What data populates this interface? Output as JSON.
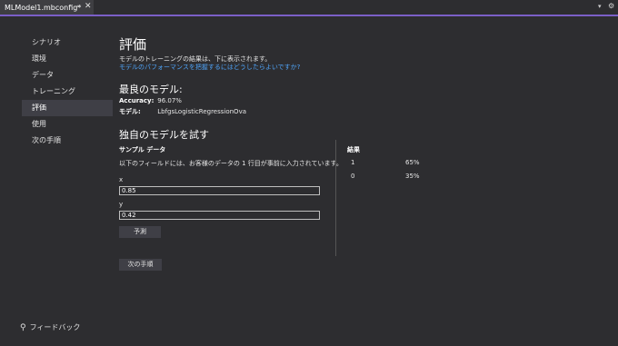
{
  "tab": {
    "title": "MLModel1.mbconfig*",
    "pin_icon": "pin-icon",
    "close_icon": "close-icon"
  },
  "sidebar": {
    "items": [
      {
        "label": "シナリオ"
      },
      {
        "label": "環境"
      },
      {
        "label": "データ"
      },
      {
        "label": "トレーニング"
      },
      {
        "label": "評価",
        "active": true
      },
      {
        "label": "使用"
      },
      {
        "label": "次の手順"
      }
    ],
    "feedback": "フィードバック"
  },
  "evaluate": {
    "title": "評価",
    "description": "モデルのトレーニングの結果は、下に表示されます。",
    "help_link": "モデルのパフォーマンスを把握するにはどうしたらよいですか?"
  },
  "best_model": {
    "heading": "最良のモデル:",
    "accuracy_label": "Accuracy:",
    "accuracy_value": "96.07%",
    "model_label": "モデル:",
    "model_value": "LbfgsLogisticRegressionOva"
  },
  "try": {
    "heading": "独自のモデルを試す",
    "sample_label": "サンプル データ",
    "sample_desc": "以下のフィールドには、お客様のデータの 1 行目が事前に入力されています。",
    "x_label": "x",
    "x_value": "0.85",
    "y_label": "y",
    "y_value": "0.42",
    "predict_button": "予測"
  },
  "results": {
    "label": "結果",
    "rows": [
      {
        "class": "1",
        "score": "65%"
      },
      {
        "class": "0",
        "score": "35%"
      }
    ]
  },
  "next_button": "次の手順",
  "colors": {
    "accent": "#7b5fc7",
    "link": "#4fa3f7",
    "background": "#2d2d30"
  }
}
